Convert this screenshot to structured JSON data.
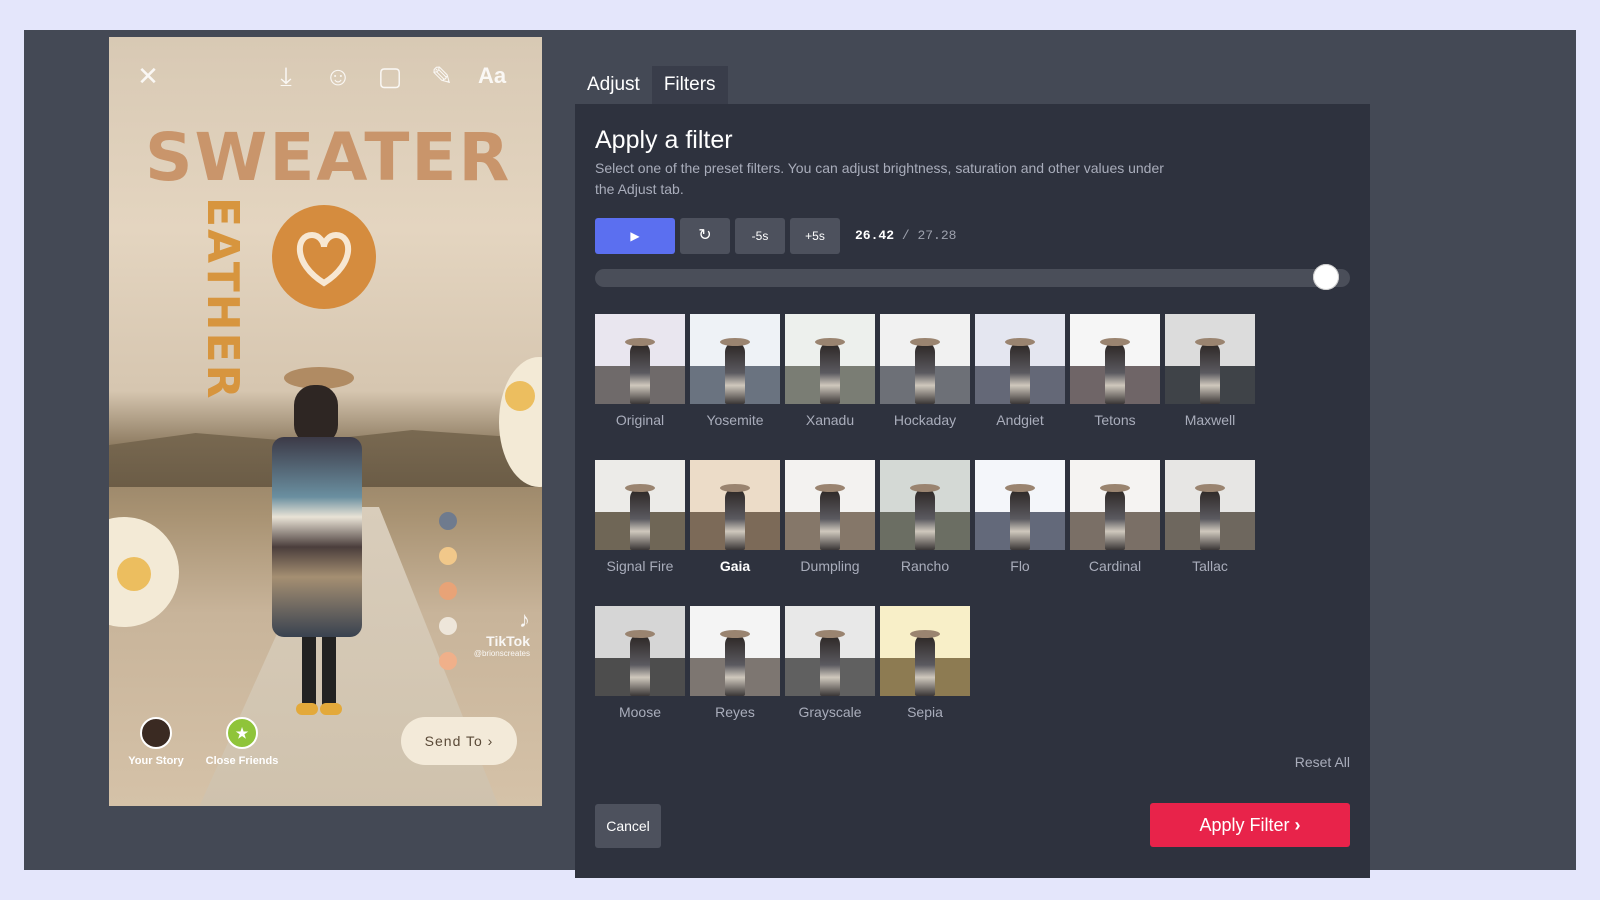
{
  "colors": {
    "accent": "#5b6ff0",
    "apply": "#e8234a",
    "panel": "#2e323e",
    "background": "#444955"
  },
  "preview": {
    "headline": "SWEATER",
    "vertical_word": "EATHER",
    "tiktok_label": "TikTok",
    "tiktok_handle": "@brionscreates",
    "your_story": "Your Story",
    "close_friends": "Close Friends",
    "send_to": "Send To",
    "icons": [
      "close-icon",
      "download-icon",
      "emoji-sticker-icon",
      "sticker-icon",
      "draw-icon",
      "text-icon"
    ]
  },
  "tabs": [
    {
      "label": "Adjust",
      "active": false
    },
    {
      "label": "Filters",
      "active": true
    }
  ],
  "panel": {
    "title": "Apply a filter",
    "description": "Select one of the preset filters. You can adjust brightness, saturation and other values under the Adjust tab."
  },
  "playback": {
    "minus_label": "-5s",
    "plus_label": "+5s",
    "current_time": "26.42",
    "separator": "/",
    "duration": "27.28",
    "progress": 0.968
  },
  "filters": [
    {
      "name": "Original",
      "sky": "#e9e6ef",
      "land": "#6f6a6a"
    },
    {
      "name": "Yosemite",
      "sky": "#eef2f6",
      "land": "#6a7380"
    },
    {
      "name": "Xanadu",
      "sky": "#edf0ed",
      "land": "#7a7d74"
    },
    {
      "name": "Hockaday",
      "sky": "#f1f1f1",
      "land": "#6d7077"
    },
    {
      "name": "Andgiet",
      "sky": "#e4e6f0",
      "land": "#646877"
    },
    {
      "name": "Tetons",
      "sky": "#f6f6f6",
      "land": "#6f6567"
    },
    {
      "name": "Maxwell",
      "sky": "#dcdcdc",
      "land": "#3f4348"
    },
    {
      "name": "Signal Fire",
      "sky": "#ecebe8",
      "land": "#6f6656"
    },
    {
      "name": "Gaia",
      "sky": "#ecdcc8",
      "land": "#7c6a58",
      "selected": true
    },
    {
      "name": "Dumpling",
      "sky": "#f3f2f0",
      "land": "#857769"
    },
    {
      "name": "Rancho",
      "sky": "#d4d9d5",
      "land": "#6b6e63"
    },
    {
      "name": "Flo",
      "sky": "#f4f6fa",
      "land": "#63697a"
    },
    {
      "name": "Cardinal",
      "sky": "#f5f3f2",
      "land": "#7a6f66"
    },
    {
      "name": "Tallac",
      "sky": "#e7e6e4",
      "land": "#6e675e"
    },
    {
      "name": "Moose",
      "sky": "#d6d6d6",
      "land": "#4d4d4d"
    },
    {
      "name": "Reyes",
      "sky": "#f4f4f4",
      "land": "#7d7671"
    },
    {
      "name": "Grayscale",
      "sky": "#e8e8e8",
      "land": "#606060"
    },
    {
      "name": "Sepia",
      "sky": "#f8efc8",
      "land": "#8d7b52"
    }
  ],
  "actions": {
    "reset_all": "Reset All",
    "cancel": "Cancel",
    "apply": "Apply Filter"
  }
}
